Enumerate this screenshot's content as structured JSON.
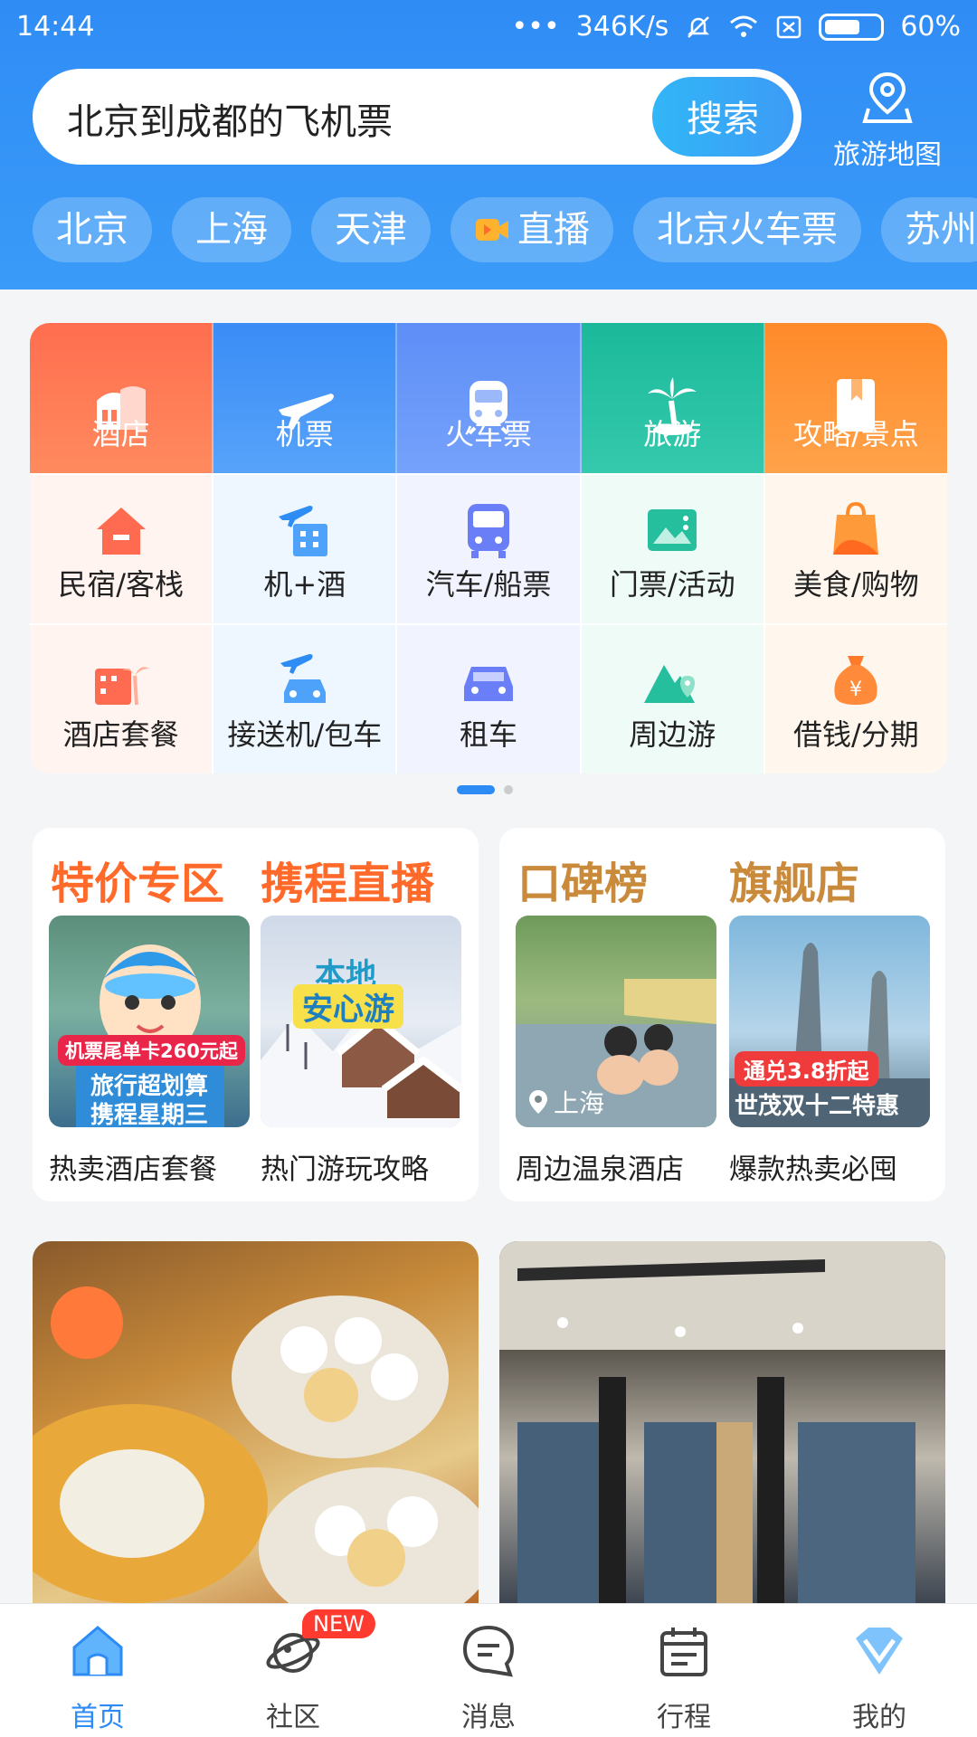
{
  "status": {
    "time": "14:44",
    "dots": "•••",
    "speed": "346K/s",
    "battery": "60%"
  },
  "search": {
    "query": "北京到成都的飞机票",
    "button": "搜索",
    "map_label": "旅游地图"
  },
  "chips": [
    "北京",
    "上海",
    "天津",
    "直播",
    "北京火车票",
    "苏州"
  ],
  "grid": {
    "row1": [
      "酒店",
      "机票",
      "火车票",
      "旅游",
      "攻略/景点"
    ],
    "row2": [
      "民宿/客栈",
      "机+酒",
      "汽车/船票",
      "门票/活动",
      "美食/购物"
    ],
    "row3": [
      "酒店套餐",
      "接送机/包车",
      "租车",
      "周边游",
      "借钱/分期"
    ]
  },
  "promo_left": {
    "title1": "特价专区",
    "title2": "携程直播",
    "img1_tag": "机票尾单卡260元起",
    "img1_line1": "旅行超划算",
    "img1_line2": "携程星期三",
    "img2_text1": "本地",
    "img2_text2": "安心游",
    "caption1": "热卖酒店套餐",
    "caption2": "热门游玩攻略"
  },
  "promo_right": {
    "title1": "口碑榜",
    "title2": "旗舰店",
    "img1_location": "上海",
    "img2_tag": "通兑3.8折起",
    "img2_line": "世茂双十二特惠",
    "caption1": "周边温泉酒店",
    "caption2": "爆款热卖必囤"
  },
  "tabs": {
    "home": "首页",
    "community": "社区",
    "new_badge": "NEW",
    "messages": "消息",
    "trips": "行程",
    "mine": "我的"
  }
}
